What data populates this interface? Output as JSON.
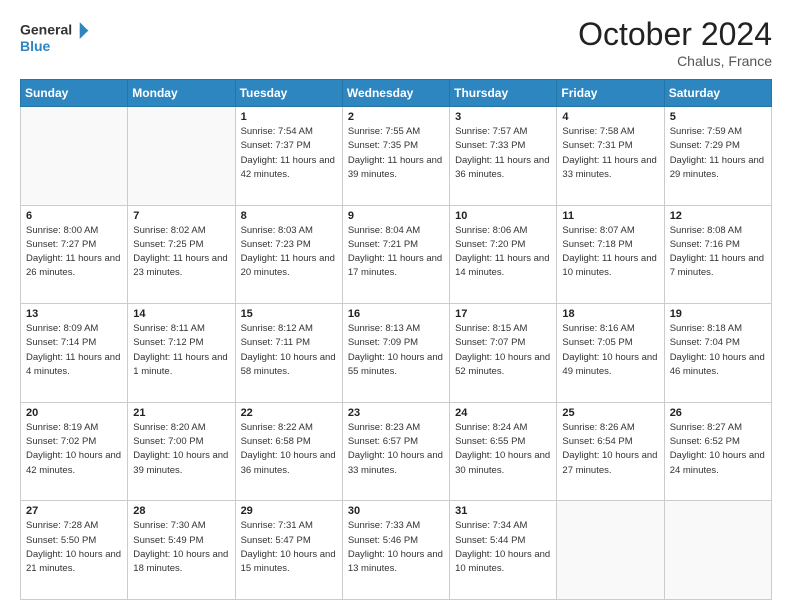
{
  "header": {
    "logo_line1": "General",
    "logo_line2": "Blue",
    "month_title": "October 2024",
    "location": "Chalus, France"
  },
  "days_of_week": [
    "Sunday",
    "Monday",
    "Tuesday",
    "Wednesday",
    "Thursday",
    "Friday",
    "Saturday"
  ],
  "weeks": [
    [
      {
        "num": "",
        "info": ""
      },
      {
        "num": "",
        "info": ""
      },
      {
        "num": "1",
        "info": "Sunrise: 7:54 AM\nSunset: 7:37 PM\nDaylight: 11 hours and 42 minutes."
      },
      {
        "num": "2",
        "info": "Sunrise: 7:55 AM\nSunset: 7:35 PM\nDaylight: 11 hours and 39 minutes."
      },
      {
        "num": "3",
        "info": "Sunrise: 7:57 AM\nSunset: 7:33 PM\nDaylight: 11 hours and 36 minutes."
      },
      {
        "num": "4",
        "info": "Sunrise: 7:58 AM\nSunset: 7:31 PM\nDaylight: 11 hours and 33 minutes."
      },
      {
        "num": "5",
        "info": "Sunrise: 7:59 AM\nSunset: 7:29 PM\nDaylight: 11 hours and 29 minutes."
      }
    ],
    [
      {
        "num": "6",
        "info": "Sunrise: 8:00 AM\nSunset: 7:27 PM\nDaylight: 11 hours and 26 minutes."
      },
      {
        "num": "7",
        "info": "Sunrise: 8:02 AM\nSunset: 7:25 PM\nDaylight: 11 hours and 23 minutes."
      },
      {
        "num": "8",
        "info": "Sunrise: 8:03 AM\nSunset: 7:23 PM\nDaylight: 11 hours and 20 minutes."
      },
      {
        "num": "9",
        "info": "Sunrise: 8:04 AM\nSunset: 7:21 PM\nDaylight: 11 hours and 17 minutes."
      },
      {
        "num": "10",
        "info": "Sunrise: 8:06 AM\nSunset: 7:20 PM\nDaylight: 11 hours and 14 minutes."
      },
      {
        "num": "11",
        "info": "Sunrise: 8:07 AM\nSunset: 7:18 PM\nDaylight: 11 hours and 10 minutes."
      },
      {
        "num": "12",
        "info": "Sunrise: 8:08 AM\nSunset: 7:16 PM\nDaylight: 11 hours and 7 minutes."
      }
    ],
    [
      {
        "num": "13",
        "info": "Sunrise: 8:09 AM\nSunset: 7:14 PM\nDaylight: 11 hours and 4 minutes."
      },
      {
        "num": "14",
        "info": "Sunrise: 8:11 AM\nSunset: 7:12 PM\nDaylight: 11 hours and 1 minute."
      },
      {
        "num": "15",
        "info": "Sunrise: 8:12 AM\nSunset: 7:11 PM\nDaylight: 10 hours and 58 minutes."
      },
      {
        "num": "16",
        "info": "Sunrise: 8:13 AM\nSunset: 7:09 PM\nDaylight: 10 hours and 55 minutes."
      },
      {
        "num": "17",
        "info": "Sunrise: 8:15 AM\nSunset: 7:07 PM\nDaylight: 10 hours and 52 minutes."
      },
      {
        "num": "18",
        "info": "Sunrise: 8:16 AM\nSunset: 7:05 PM\nDaylight: 10 hours and 49 minutes."
      },
      {
        "num": "19",
        "info": "Sunrise: 8:18 AM\nSunset: 7:04 PM\nDaylight: 10 hours and 46 minutes."
      }
    ],
    [
      {
        "num": "20",
        "info": "Sunrise: 8:19 AM\nSunset: 7:02 PM\nDaylight: 10 hours and 42 minutes."
      },
      {
        "num": "21",
        "info": "Sunrise: 8:20 AM\nSunset: 7:00 PM\nDaylight: 10 hours and 39 minutes."
      },
      {
        "num": "22",
        "info": "Sunrise: 8:22 AM\nSunset: 6:58 PM\nDaylight: 10 hours and 36 minutes."
      },
      {
        "num": "23",
        "info": "Sunrise: 8:23 AM\nSunset: 6:57 PM\nDaylight: 10 hours and 33 minutes."
      },
      {
        "num": "24",
        "info": "Sunrise: 8:24 AM\nSunset: 6:55 PM\nDaylight: 10 hours and 30 minutes."
      },
      {
        "num": "25",
        "info": "Sunrise: 8:26 AM\nSunset: 6:54 PM\nDaylight: 10 hours and 27 minutes."
      },
      {
        "num": "26",
        "info": "Sunrise: 8:27 AM\nSunset: 6:52 PM\nDaylight: 10 hours and 24 minutes."
      }
    ],
    [
      {
        "num": "27",
        "info": "Sunrise: 7:28 AM\nSunset: 5:50 PM\nDaylight: 10 hours and 21 minutes."
      },
      {
        "num": "28",
        "info": "Sunrise: 7:30 AM\nSunset: 5:49 PM\nDaylight: 10 hours and 18 minutes."
      },
      {
        "num": "29",
        "info": "Sunrise: 7:31 AM\nSunset: 5:47 PM\nDaylight: 10 hours and 15 minutes."
      },
      {
        "num": "30",
        "info": "Sunrise: 7:33 AM\nSunset: 5:46 PM\nDaylight: 10 hours and 13 minutes."
      },
      {
        "num": "31",
        "info": "Sunrise: 7:34 AM\nSunset: 5:44 PM\nDaylight: 10 hours and 10 minutes."
      },
      {
        "num": "",
        "info": ""
      },
      {
        "num": "",
        "info": ""
      }
    ]
  ]
}
